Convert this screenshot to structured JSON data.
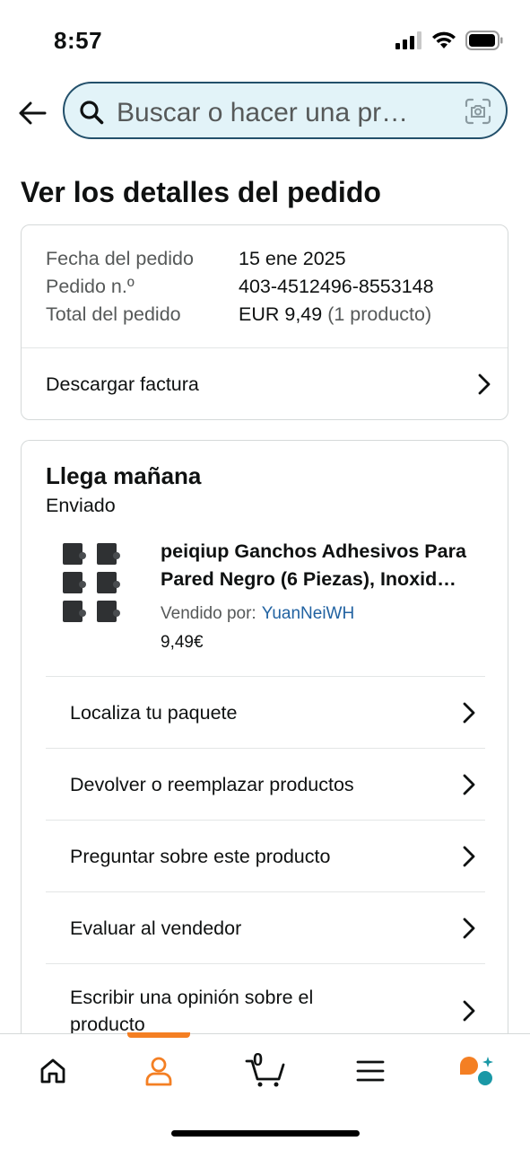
{
  "status_bar": {
    "time": "8:57"
  },
  "search": {
    "placeholder": "Buscar o hacer una pr…"
  },
  "page": {
    "title": "Ver los detalles del pedido"
  },
  "order_summary": {
    "date_label": "Fecha del pedido",
    "date_value": "15 ene 2025",
    "number_label": "Pedido n.º",
    "number_value": "403-4512496-8553148",
    "total_label": "Total del pedido",
    "total_value": "EUR 9,49",
    "total_extra": "(1 producto)",
    "invoice_label": "Descargar factura"
  },
  "shipment": {
    "heading": "Llega mañana",
    "status": "Enviado",
    "product": {
      "title_line1": "peiqiup Ganchos Adhesivos Para",
      "title_line2": "Pared Negro (6 Piezas), Inoxid…",
      "seller_label": "Vendido por:",
      "seller_name": "YuanNeiWH",
      "price": "9,49€"
    },
    "actions": [
      {
        "label": "Localiza tu paquete"
      },
      {
        "label": "Devolver o reemplazar productos"
      },
      {
        "label": "Preguntar sobre este producto"
      },
      {
        "label": "Evaluar al vendedor"
      },
      {
        "label": "Escribir una opinión sobre el producto"
      }
    ]
  },
  "bottom_nav": {
    "items": [
      "home-icon",
      "account-icon",
      "cart-icon",
      "menu-icon",
      "assistant-icon"
    ],
    "active": "account-icon",
    "cart_count": "0",
    "accent_color": "#f47f23"
  }
}
